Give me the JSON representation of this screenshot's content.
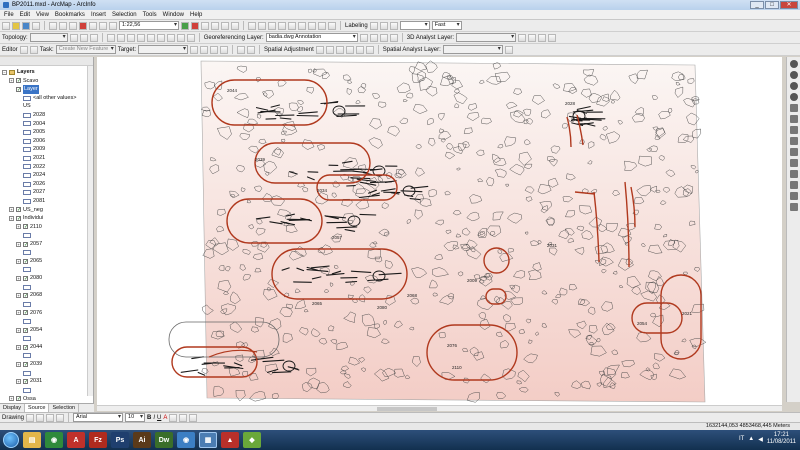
{
  "window": {
    "title": "BP2011.mxd - ArcMap - ArcInfo",
    "min": "_",
    "max": "□",
    "close": "✕"
  },
  "menu": [
    "File",
    "Edit",
    "View",
    "Bookmarks",
    "Insert",
    "Selection",
    "Tools",
    "Window",
    "Help"
  ],
  "toolbar1": {
    "scale": "1:22,56",
    "labeling_label": "Labeling",
    "labeling_combo": "",
    "font_size": "Fast"
  },
  "toolbar2": {
    "topology_label": "Topology:",
    "georeferencing_label": "Georeferencing",
    "layer_label": "Layer:",
    "layer_value": "badia.dwg Annotation",
    "analyst_label": "3D Analyst",
    "layer2_label": "Layer:"
  },
  "toolbar3": {
    "editor_label": "Editor",
    "task_label": "Task:",
    "task_value": "Create New Feature",
    "target_label": "Target:",
    "spatial_adjustment_label": "Spatial Adjustment",
    "spatial_analyst_label": "Spatial Analyst",
    "layer3_label": "Layer:"
  },
  "toc": {
    "header": "",
    "items": [
      {
        "label": "Layers",
        "level": 0,
        "kind": "root"
      },
      {
        "label": "Scavo",
        "level": 1,
        "kind": "layer"
      },
      {
        "label": "Layer",
        "level": 2,
        "kind": "selected"
      },
      {
        "label": "<all other values>",
        "level": 3,
        "kind": "swatch"
      },
      {
        "label": "US",
        "level": 3,
        "kind": "text"
      },
      {
        "label": "2028",
        "level": 3,
        "kind": "swatch"
      },
      {
        "label": "2004",
        "level": 3,
        "kind": "swatch"
      },
      {
        "label": "2005",
        "level": 3,
        "kind": "swatch"
      },
      {
        "label": "2006",
        "level": 3,
        "kind": "swatch"
      },
      {
        "label": "2009",
        "level": 3,
        "kind": "swatch"
      },
      {
        "label": "2021",
        "level": 3,
        "kind": "swatch"
      },
      {
        "label": "2022",
        "level": 3,
        "kind": "swatch"
      },
      {
        "label": "2024",
        "level": 3,
        "kind": "swatch"
      },
      {
        "label": "2026",
        "level": 3,
        "kind": "swatch"
      },
      {
        "label": "2027",
        "level": 3,
        "kind": "swatch"
      },
      {
        "label": "2081",
        "level": 3,
        "kind": "swatch"
      },
      {
        "label": "US_neg",
        "level": 1,
        "kind": "layer"
      },
      {
        "label": "Individui",
        "level": 1,
        "kind": "layer"
      },
      {
        "label": "2110",
        "level": 2,
        "kind": "layer"
      },
      {
        "label": "",
        "level": 3,
        "kind": "swatch"
      },
      {
        "label": "2057",
        "level": 2,
        "kind": "layer"
      },
      {
        "label": "",
        "level": 3,
        "kind": "swatch"
      },
      {
        "label": "2065",
        "level": 2,
        "kind": "layer"
      },
      {
        "label": "",
        "level": 3,
        "kind": "swatch"
      },
      {
        "label": "2080",
        "level": 2,
        "kind": "layer"
      },
      {
        "label": "",
        "level": 3,
        "kind": "swatch"
      },
      {
        "label": "2068",
        "level": 2,
        "kind": "layer"
      },
      {
        "label": "",
        "level": 3,
        "kind": "swatch"
      },
      {
        "label": "2076",
        "level": 2,
        "kind": "layer"
      },
      {
        "label": "",
        "level": 3,
        "kind": "swatch"
      },
      {
        "label": "2054",
        "level": 2,
        "kind": "layer"
      },
      {
        "label": "",
        "level": 3,
        "kind": "swatch"
      },
      {
        "label": "2044",
        "level": 2,
        "kind": "layer"
      },
      {
        "label": "",
        "level": 3,
        "kind": "swatch"
      },
      {
        "label": "2039",
        "level": 2,
        "kind": "layer"
      },
      {
        "label": "",
        "level": 3,
        "kind": "swatch"
      },
      {
        "label": "2031",
        "level": 2,
        "kind": "layer"
      },
      {
        "label": "",
        "level": 3,
        "kind": "swatch"
      },
      {
        "label": "Ossa",
        "level": 1,
        "kind": "layer"
      },
      {
        "label": "US_pos",
        "level": 1,
        "kind": "layer"
      },
      {
        "label": "Reperti",
        "level": 1,
        "kind": "layer"
      },
      {
        "label": "",
        "level": 3,
        "kind": "star"
      },
      {
        "label": "Aree",
        "level": 1,
        "kind": "layer"
      }
    ],
    "tabs": [
      "Display",
      "Source",
      "Selection"
    ]
  },
  "map": {
    "labels": [
      "2044",
      "2039",
      "2034",
      "2057",
      "2028",
      "2031",
      "2065",
      "2080",
      "2076",
      "2110",
      "2054",
      "2009",
      "2068",
      "2021"
    ],
    "colors": {
      "sketch": "#b0391e",
      "lines": "#444444",
      "bg_top": "#fbf6f4",
      "bg_bottom": "#f3cdc6"
    }
  },
  "drawing": {
    "drawing_label": "Drawing",
    "font": "Arial",
    "size": "10",
    "bold": "B",
    "italic": "I",
    "underline": "U",
    "text_a": "A"
  },
  "status": {
    "coords": "1632144,053  4853468,445 Meters"
  },
  "taskbar": {
    "apps": [
      "explorer",
      "chrome",
      "acrobat",
      "filezilla",
      "photoshop",
      "illustrator",
      "dreamweaver",
      "chrome2",
      "arcmap",
      "pdf",
      "other"
    ],
    "lang": "IT",
    "time": "17:21",
    "date": "11/08/2011"
  }
}
